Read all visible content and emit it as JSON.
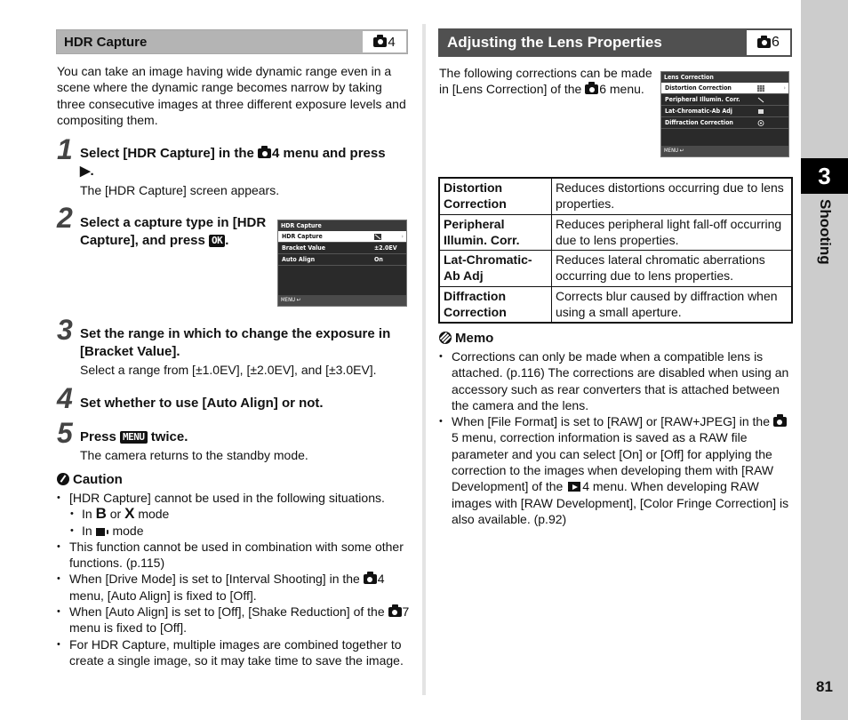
{
  "left_section": {
    "title": "HDR Capture",
    "menu_ref": "4",
    "intro": "You can take an image having wide dynamic range even in a scene where the dynamic range becomes narrow by taking three consecutive images at three different exposure levels and compositing them.",
    "steps": [
      {
        "num": "1",
        "title_pre": "Select [HDR Capture] in the ",
        "title_menu": "4",
        "title_post": " menu and press",
        "title_line2": "▶.",
        "desc": "The [HDR Capture] screen appears."
      },
      {
        "num": "2",
        "title_pre": "Select a capture type in [HDR Capture], and press ",
        "key": "OK",
        "title_post": "."
      },
      {
        "num": "3",
        "title": "Set the range in which to change the exposure in [Bracket Value].",
        "desc": "Select a range from [±1.0EV], [±2.0EV], and [±3.0EV]."
      },
      {
        "num": "4",
        "title": "Set whether to use [Auto Align] or not."
      },
      {
        "num": "5",
        "title_pre": "Press ",
        "key": "MENU",
        "title_post": " twice.",
        "desc": "The camera returns to the standby mode."
      }
    ],
    "screen": {
      "title": "HDR Capture",
      "rows": [
        {
          "label": "HDR Capture",
          "value": "",
          "icon": "hdr-icon",
          "selected": true
        },
        {
          "label": "Bracket Value",
          "value": "±2.0EV",
          "selected": false
        },
        {
          "label": "Auto Align",
          "value": "On",
          "selected": false
        }
      ],
      "footer": "MENU"
    },
    "caution": {
      "heading": "Caution",
      "items": [
        {
          "text": "[HDR Capture] cannot be used in the following situations.",
          "sub": [
            {
              "pre": "In ",
              "b": "B",
              "mid": " or ",
              "x": "X",
              "post": " mode"
            },
            {
              "pre": "In ",
              "post": " mode"
            }
          ]
        },
        {
          "text": "This function cannot be used in combination with some other functions. (p.115)"
        },
        {
          "pre": "When [Drive Mode] is set to [Interval Shooting] in the ",
          "menu": "4",
          "post": " menu, [Auto Align] is fixed to [Off]."
        },
        {
          "pre": "When [Auto Align] is set to [Off], [Shake Reduction] of the ",
          "menu": "7",
          "post": " menu is fixed to [Off]."
        },
        {
          "text": "For HDR Capture, multiple images are combined together to create a single image, so it may take time to save the image."
        }
      ]
    }
  },
  "right_section": {
    "title": "Adjusting the Lens Properties",
    "menu_ref": "6",
    "intro_pre": "The following corrections can be made in [Lens Correction] of the ",
    "intro_menu": "6",
    "intro_post": " menu.",
    "screen": {
      "title": "Lens Correction",
      "rows": [
        {
          "label": "Distortion Correction",
          "icon": "distortion-icon",
          "selected": true
        },
        {
          "label": "Peripheral Illumin. Corr.",
          "icon": "peripheral-icon",
          "selected": false
        },
        {
          "label": "Lat-Chromatic-Ab Adj",
          "icon": "chromatic-icon",
          "selected": false
        },
        {
          "label": "Diffraction Correction",
          "icon": "diffraction-icon",
          "selected": false
        }
      ],
      "footer": "MENU"
    },
    "table": [
      {
        "key": "Distortion Correction",
        "desc": "Reduces distortions occurring due to lens properties."
      },
      {
        "key": "Peripheral Illumin. Corr.",
        "desc": "Reduces peripheral light fall-off occurring due to lens properties."
      },
      {
        "key": "Lat-Chromatic-Ab Adj",
        "desc": "Reduces lateral chromatic aberrations occurring due to lens properties."
      },
      {
        "key": "Diffraction Correction",
        "desc": "Corrects blur caused by diffraction when using a small aperture."
      }
    ],
    "memo": {
      "heading": "Memo",
      "items": [
        {
          "text": "Corrections can only be made when a compatible lens is attached. (p.116) The corrections are disabled when using an accessory such as rear converters that is attached between the camera and the lens."
        },
        {
          "pre": "When [File Format] is set to [RAW] or [RAW+JPEG] in the ",
          "menu": "5",
          "mid": " menu, correction information is saved as a RAW file parameter and you can select [On] or [Off] for applying the correction to the images when developing them with [RAW Development] of the ",
          "play_menu": "4",
          "post": " menu. When developing RAW images with [RAW Development], [Color Fringe Correction] is also available. (p.92)"
        }
      ]
    }
  },
  "sidebar": {
    "chapter_number": "3",
    "chapter_label": "Shooting",
    "page_number": "81"
  }
}
